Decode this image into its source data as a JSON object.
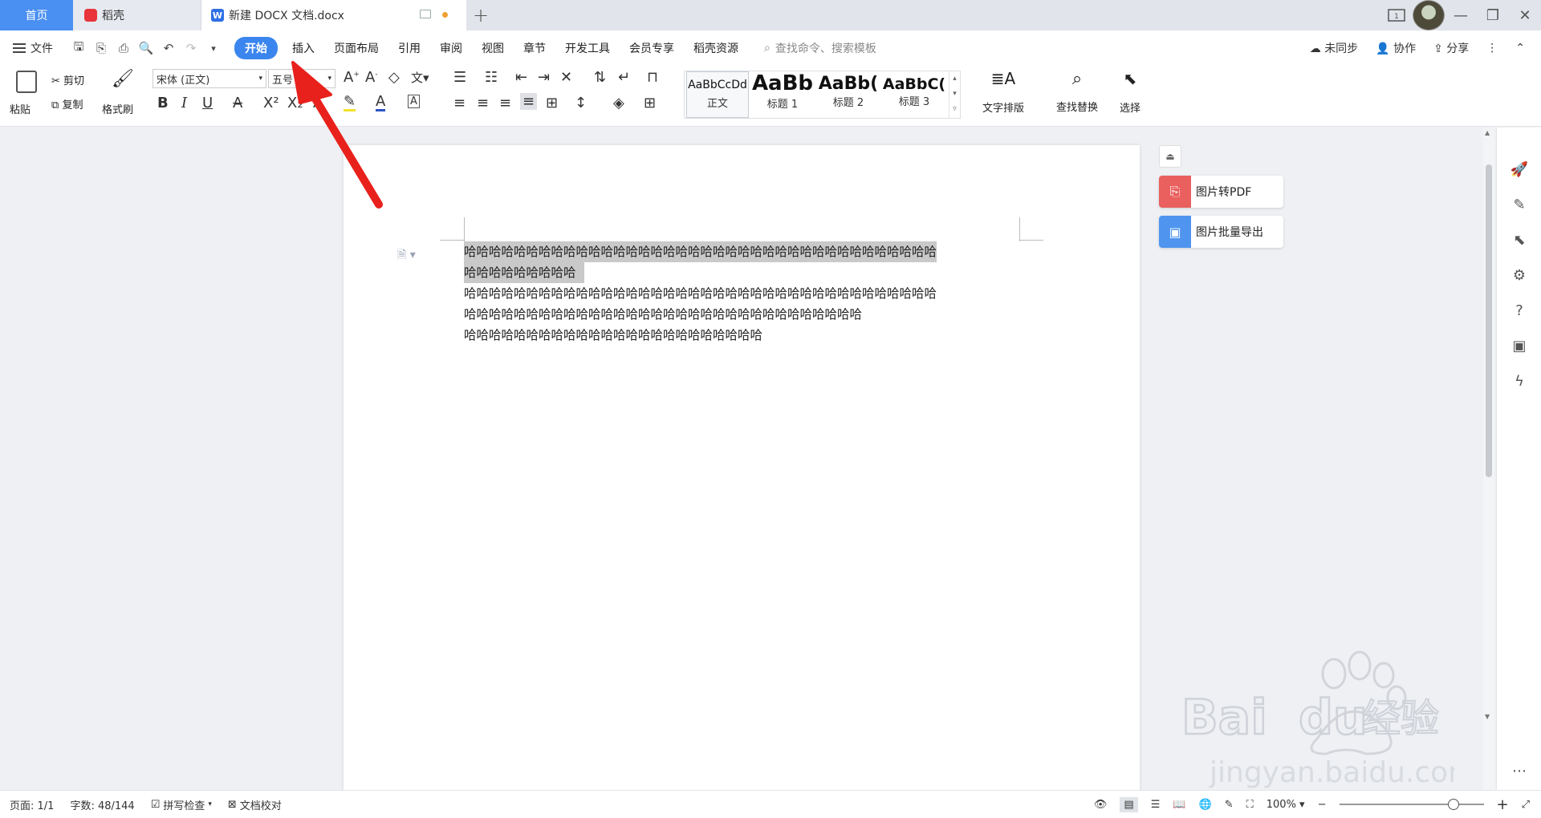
{
  "tabs": {
    "home": "首页",
    "daoke": "稻壳",
    "doc": "新建 DOCX 文档.docx"
  },
  "menubar": {
    "file": "文件",
    "items": [
      "开始",
      "插入",
      "页面布局",
      "引用",
      "审阅",
      "视图",
      "章节",
      "开发工具",
      "会员专享",
      "稻壳资源"
    ],
    "search": "查找命令、搜索模板",
    "sync": "未同步",
    "collab": "协作",
    "share": "分享"
  },
  "ribbon": {
    "paste": "粘贴",
    "cut": "剪切",
    "copy": "复制",
    "format_painter": "格式刷",
    "font_name": "宋体 (正文)",
    "font_size": "五号",
    "styles": [
      {
        "preview": "AaBbCcDd",
        "name": "正文"
      },
      {
        "preview": "AaBb",
        "name": "标题 1"
      },
      {
        "preview": "AaBb(",
        "name": "标题 2"
      },
      {
        "preview": "AaBbC(",
        "name": "标题 3"
      }
    ],
    "text_layout": "文字排版",
    "find_replace": "查找替换",
    "select": "选择"
  },
  "document": {
    "lines": [
      "哈哈哈哈哈哈哈哈哈哈哈哈哈哈哈哈哈哈哈哈哈哈哈哈哈哈哈哈哈哈哈哈哈哈哈哈哈哈",
      "哈哈哈哈哈哈哈哈哈",
      "哈哈哈哈哈哈哈哈哈哈哈哈哈哈哈哈哈哈哈哈哈哈哈哈哈哈哈哈哈哈哈哈哈哈哈哈哈哈",
      "哈哈哈哈哈哈哈哈哈哈哈哈哈哈哈哈哈哈哈哈哈哈哈哈哈哈哈哈哈哈哈哈",
      "哈哈哈哈哈哈哈哈哈哈哈哈哈哈哈哈哈哈哈哈哈哈哈哈"
    ]
  },
  "side_tools": {
    "img_to_pdf": "图片转PDF",
    "img_batch_export": "图片批量导出"
  },
  "statusbar": {
    "page": "页面: 1/1",
    "words": "字数: 48/144",
    "spell": "拼写检查",
    "proof": "文档校对",
    "zoom": "100%"
  },
  "colors": {
    "accent": "#3b86ee",
    "home_tab": "#4a8ff2",
    "arrow": "#e8211c"
  }
}
